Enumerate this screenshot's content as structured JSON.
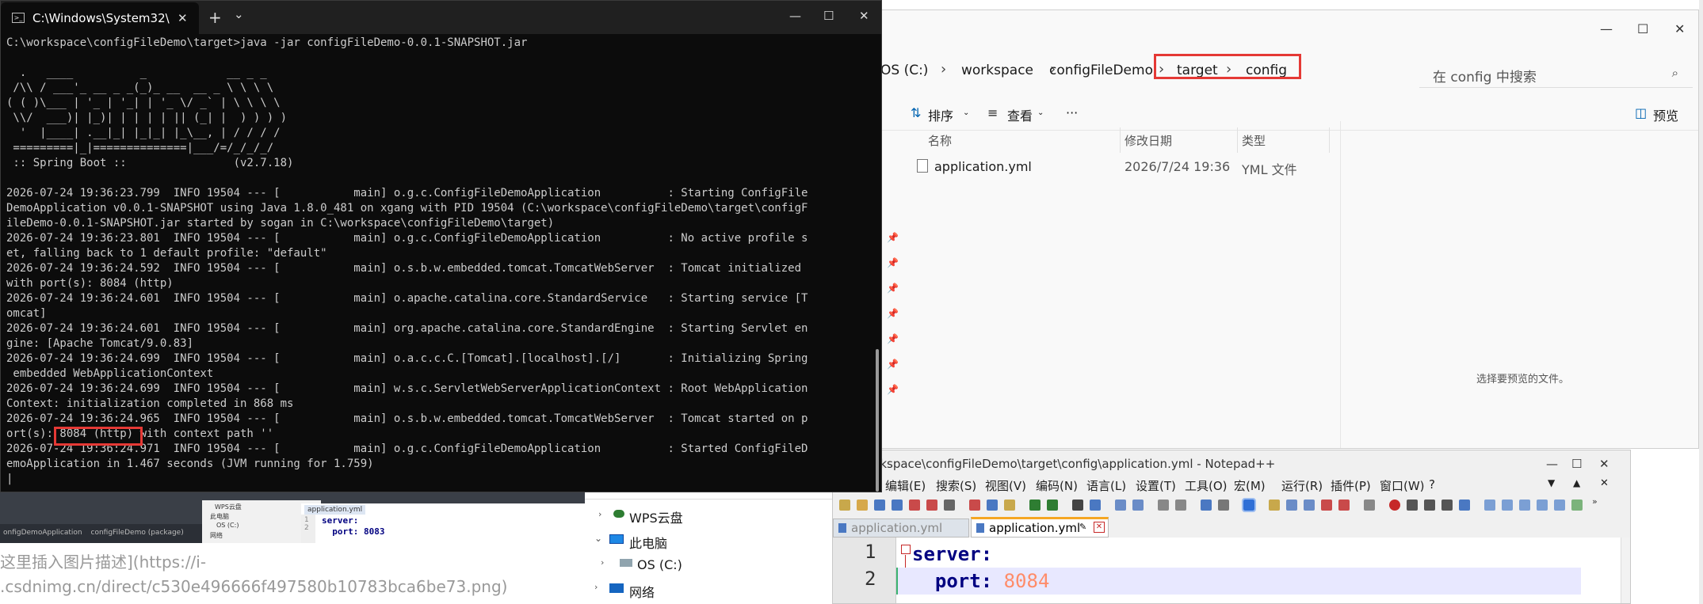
{
  "cmd": {
    "title": "C:\\Windows\\System32\\",
    "tab_add": "+",
    "tab_dropdown": "⌄",
    "minimize": "—",
    "maximize": "☐",
    "close": "✕",
    "lines": [
      "C:\\workspace\\configFileDemo\\target>java -jar configFileDemo-0.0.1-SNAPSHOT.jar",
      "",
      "  .   ____          _            __ _ _",
      " /\\\\ / ___'_ __ _ _(_)_ __  __ _ \\ \\ \\ \\",
      "( ( )\\___ | '_ | '_| | '_ \\/ _` | \\ \\ \\ \\",
      " \\\\/  ___)| |_)| | | | | || (_| |  ) ) ) )",
      "  '  |____| .__|_| |_|_| |_\\__, | / / / /",
      " =========|_|==============|___/=/_/_/_/",
      " :: Spring Boot ::                (v2.7.18)",
      "",
      "2026-07-24 19:36:23.799  INFO 19504 --- [           main] o.g.c.ConfigFileDemoApplication          : Starting ConfigFile",
      "DemoApplication v0.0.1-SNAPSHOT using Java 1.8.0_481 on xgang with PID 19504 (C:\\workspace\\configFileDemo\\target\\configF",
      "ileDemo-0.0.1-SNAPSHOT.jar started by sogan in C:\\workspace\\configFileDemo\\target)",
      "2026-07-24 19:36:23.801  INFO 19504 --- [           main] o.g.c.ConfigFileDemoApplication          : No active profile s",
      "et, falling back to 1 default profile: \"default\"",
      "2026-07-24 19:36:24.592  INFO 19504 --- [           main] o.s.b.w.embedded.tomcat.TomcatWebServer  : Tomcat initialized",
      "with port(s): 8084 (http)",
      "2026-07-24 19:36:24.601  INFO 19504 --- [           main] o.apache.catalina.core.StandardService   : Starting service [T",
      "omcat]",
      "2026-07-24 19:36:24.601  INFO 19504 --- [           main] org.apache.catalina.core.StandardEngine  : Starting Servlet en",
      "gine: [Apache Tomcat/9.0.83]",
      "2026-07-24 19:36:24.699  INFO 19504 --- [           main] o.a.c.c.C.[Tomcat].[localhost].[/]       : Initializing Spring",
      " embedded WebApplicationContext",
      "2026-07-24 19:36:24.699  INFO 19504 --- [           main] w.s.c.ServletWebServerApplicationContext : Root WebApplication",
      "Context: initialization completed in 868 ms",
      "2026-07-24 19:36:24.965  INFO 19504 --- [           main] o.s.b.w.embedded.tomcat.TomcatWebServer  : Tomcat started on p",
      "ort(s): 8084 (http) with context path ''",
      "2026-07-24 19:36:24.971  INFO 19504 --- [           main] o.g.c.ConfigFileDemoApplication          : Started ConfigFileD",
      "emoApplication in 1.467 seconds (JVM running for 1.759)",
      "|"
    ]
  },
  "explorer": {
    "minimize": "—",
    "maximize": "☐",
    "close": "✕",
    "breadcrumbs": [
      "OS (C:)",
      "workspace",
      "configFileDemo",
      "target",
      "config"
    ],
    "search_placeholder": "在 config 中搜索",
    "toolbar": {
      "sort": "排序",
      "view": "查看",
      "more": "···",
      "preview": "预览"
    },
    "columns": {
      "name": "名称",
      "date": "修改日期",
      "type": "类型"
    },
    "file": {
      "name": "application.yml",
      "date": "2026/7/24 19:36",
      "type": "YML 文件"
    },
    "preview_message": "选择要预览的文件。",
    "nav": {
      "wps": "WPS云盘",
      "this_pc": "此电脑",
      "drive": "OS (C:)",
      "network": "网络"
    }
  },
  "background": {
    "caption_line1": "这里插入图片描述](https://i-",
    "caption_line2": ".csdnimg.cn/direct/c530e496666f497580b10783bca6be73.png)",
    "thumb_tree": [
      "WPS云盘",
      "此电脑",
      "OS (C:)",
      "网络"
    ],
    "thumb_tab": "application.yml",
    "thumb_code": [
      "server:",
      "  port: 8083"
    ],
    "thumb_footer1": "onfigDemoApplication",
    "thumb_footer2": "configFileDemo (package)"
  },
  "npp": {
    "title": "orkspace\\configFileDemo\\target\\config\\application.yml - Notepad++",
    "minimize": "—",
    "maximize": "☐",
    "close": "✕",
    "menus": [
      "编辑(E)",
      "搜索(S)",
      "视图(V)",
      "编码(N)",
      "语言(L)",
      "设置(T)",
      "工具(O)",
      "宏(M)",
      "运行(R)",
      "插件(P)",
      "窗口(W)",
      "?"
    ],
    "tabs": [
      "application.yml",
      "application.yml"
    ],
    "line_numbers": [
      "1",
      "2"
    ],
    "code": {
      "line1_key": "server:",
      "line2_key": "port:",
      "line2_value": "8084"
    }
  }
}
